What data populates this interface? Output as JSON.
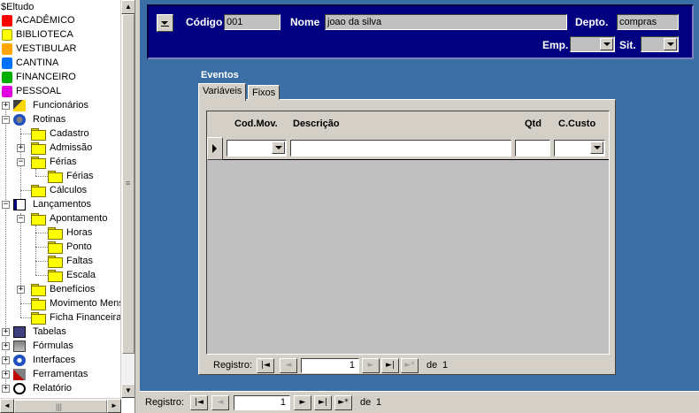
{
  "tree": {
    "root": "$Eltudo",
    "modules": [
      {
        "label": "ACADÊMICO",
        "color": "#ff0000"
      },
      {
        "label": "BIBLIOTECA",
        "color": "#ffff00"
      },
      {
        "label": "VESTIBULAR",
        "color": "#ffa500"
      },
      {
        "label": "CANTINA",
        "color": "#0070ff"
      },
      {
        "label": "FINANCEIRO",
        "color": "#00b000"
      },
      {
        "label": "PESSOAL",
        "color": "#e000e0"
      }
    ],
    "funcionarios": "Funcionários",
    "rotinas": "Rotinas",
    "cadastro": "Cadastro",
    "admissao": "Admissão",
    "ferias": "Férias",
    "ferias_sub": "Férias",
    "calculos": "Cálculos",
    "lancamentos": "Lançamentos",
    "apontamento": "Apontamento",
    "horas": "Horas",
    "ponto": "Ponto",
    "faltas": "Faltas",
    "escala": "Escala",
    "beneficios": "Benefícios",
    "movimento_mensal": "Movimento Mens",
    "ficha_financeira": "Ficha Financeira",
    "tabelas": "Tabelas",
    "formulas": "Fórmulas",
    "interfaces": "Interfaces",
    "ferramentas": "Ferramentas",
    "relatorio": "Relatório"
  },
  "header": {
    "codigo_label": "Código",
    "codigo_value": "001",
    "nome_label": "Nome",
    "nome_value": "joao da silva",
    "depto_label": "Depto.",
    "depto_value": "compras",
    "emp_label": "Emp.",
    "sit_label": "Sit."
  },
  "eventos": {
    "title": "Eventos",
    "tabs": [
      {
        "label": "Variáveis",
        "active": true
      },
      {
        "label": "Fixos",
        "active": false
      }
    ],
    "columns": [
      "Cod.Mov.",
      "Descrição",
      "Qtd",
      "C.Custo"
    ]
  },
  "subform_nav": {
    "label": "Registro:",
    "current": "1",
    "of_label": "de",
    "total": "1"
  },
  "main_nav": {
    "label": "Registro:",
    "current": "1",
    "of_label": "de",
    "total": "1"
  },
  "colors": {
    "background": "#3a6ea5",
    "header_panel": "#000080",
    "chrome": "#d4d0c8"
  }
}
